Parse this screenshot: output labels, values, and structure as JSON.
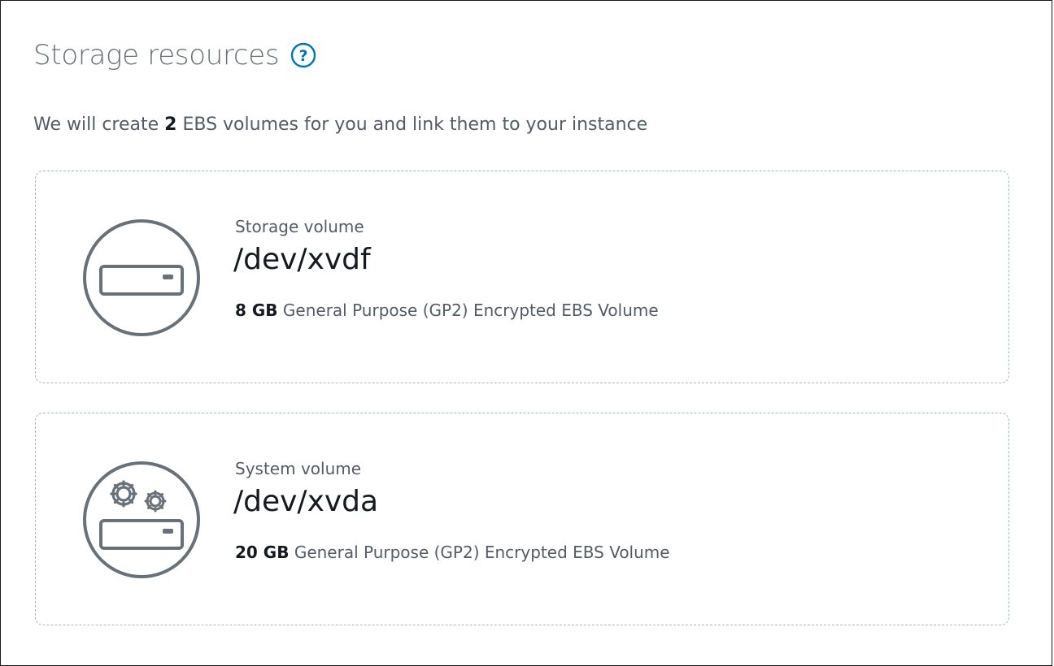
{
  "header": {
    "title": "Storage resources",
    "help_icon": "question-circle-icon"
  },
  "intro": {
    "prefix": "We will create",
    "count": "2",
    "suffix": "EBS volumes for you and link them to your instance"
  },
  "volumes": [
    {
      "kind": "Storage volume",
      "device": "/dev/xvdf",
      "size": "8 GB",
      "description": "General Purpose (GP2) Encrypted EBS Volume",
      "icon": "storage-drive-icon"
    },
    {
      "kind": "System volume",
      "device": "/dev/xvda",
      "size": "20 GB",
      "description": "General Purpose (GP2) Encrypted EBS Volume",
      "icon": "system-drive-gears-icon"
    }
  ],
  "colors": {
    "accent": "#0073bb",
    "icon_stroke": "#687078",
    "border_dashed": "#aab7b8"
  }
}
